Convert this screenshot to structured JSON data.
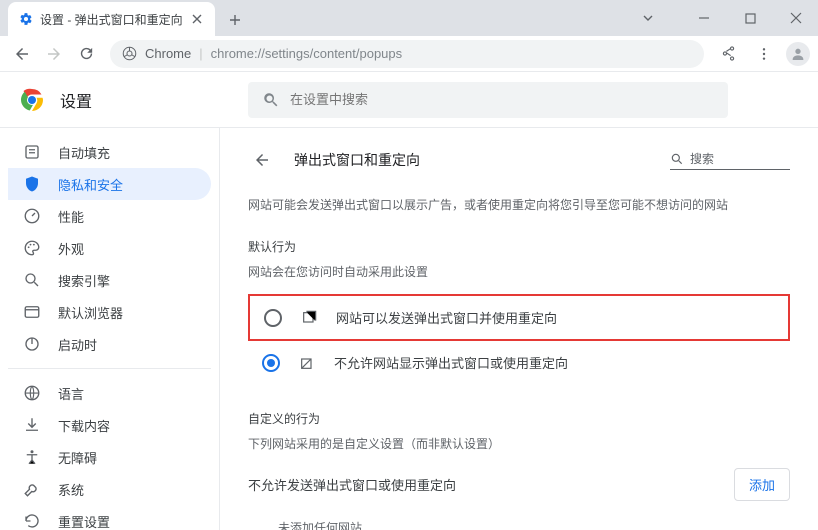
{
  "window": {
    "tab_title": "设置 - 弹出式窗口和重定向",
    "url_origin": "Chrome",
    "url_path": "chrome://settings/content/popups"
  },
  "header": {
    "title": "设置",
    "search_placeholder": "在设置中搜索"
  },
  "sidebar": {
    "items": [
      {
        "icon": "autofill",
        "label": "自动填充"
      },
      {
        "icon": "shield",
        "label": "隐私和安全"
      },
      {
        "icon": "performance",
        "label": "性能"
      },
      {
        "icon": "appearance",
        "label": "外观"
      },
      {
        "icon": "search",
        "label": "搜索引擎"
      },
      {
        "icon": "default-browser",
        "label": "默认浏览器"
      },
      {
        "icon": "startup",
        "label": "启动时"
      }
    ],
    "extra": [
      {
        "icon": "language",
        "label": "语言"
      },
      {
        "icon": "downloads",
        "label": "下载内容"
      },
      {
        "icon": "accessibility",
        "label": "无障碍"
      },
      {
        "icon": "system",
        "label": "系统"
      },
      {
        "icon": "reset",
        "label": "重置设置"
      }
    ],
    "active_index": 1
  },
  "content": {
    "page_title": "弹出式窗口和重定向",
    "search_label": "搜索",
    "desc": "网站可能会发送弹出式窗口以展示广告，或者使用重定向将您引导至您可能不想访问的网站",
    "default_label": "默认行为",
    "default_sub": "网站会在您访问时自动采用此设置",
    "radio_allow": "网站可以发送弹出式窗口并使用重定向",
    "radio_block": "不允许网站显示弹出式窗口或使用重定向",
    "custom_label": "自定义的行为",
    "custom_sub": "下列网站采用的是自定义设置（而非默认设置）",
    "block_section_label": "不允许发送弹出式窗口或使用重定向",
    "add_button": "添加",
    "empty": "未添加任何网站"
  }
}
